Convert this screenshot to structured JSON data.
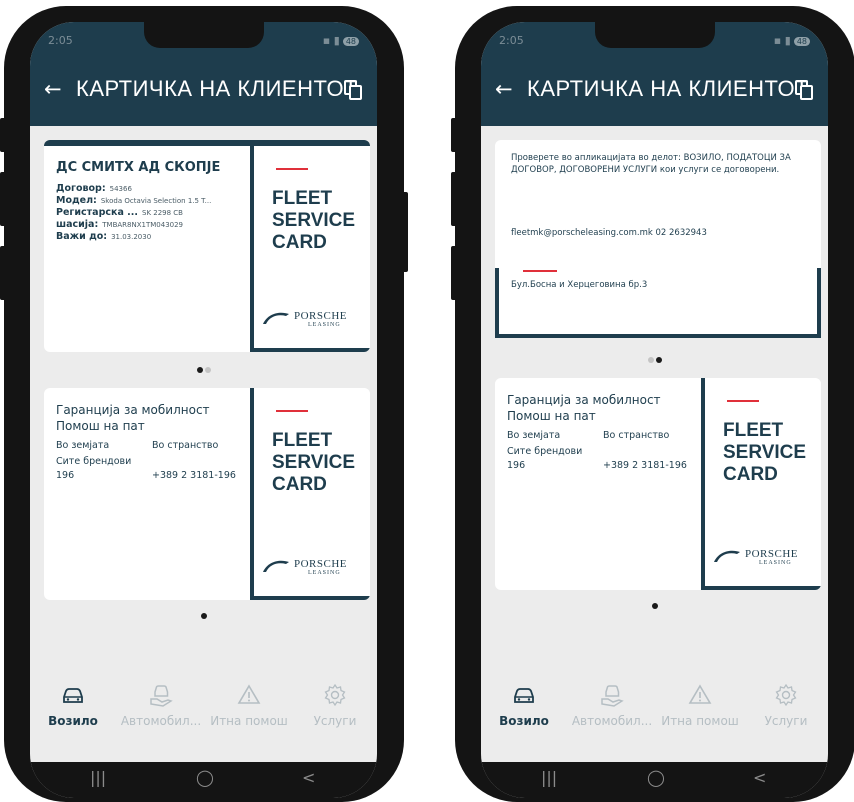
{
  "screens": [
    {
      "status": {
        "time": "2:05",
        "battery": "48"
      },
      "title": "КАРТИЧКА НА КЛИЕНТОТ",
      "vehicle_card": {
        "company": "ДС СМИТХ АД СКОПЈЕ",
        "rows": [
          {
            "label": "Договор:",
            "value": "54366"
          },
          {
            "label": "Модел:",
            "value": "Skoda Octavia Selection 1.5 T..."
          },
          {
            "label": "Регистарска ...",
            "value": "SK 2298 CB"
          },
          {
            "label": "шасија:",
            "value": "TMBAR8NX1TM043029"
          },
          {
            "label": "Важи до:",
            "value": "31.03.2030"
          }
        ]
      },
      "pager_1_active": 0,
      "guarantee_card": {
        "title_line1": "Гаранција за мобилност",
        "title_line2": "Помош на пат",
        "col_domestic": "Во земјата",
        "col_abroad": "Во странство",
        "all_brands": "Сите брендови",
        "domestic_number": "196",
        "abroad_number": "+389 2 3181-196"
      }
    },
    {
      "status": {
        "time": "2:05",
        "battery": "48"
      },
      "title": "КАРТИЧКА НА КЛИЕНТОТ",
      "info_card": {
        "instructions": "Проверете во апликацијата во делот: ВОЗИЛО, ПОДАТОЦИ ЗА ДОГОВОР, ДОГОВОРЕНИ УСЛУГИ кои услуги се договорени.",
        "contact": "fleetmk@porscheleasing.com.mk 02 2632943",
        "address": "Бул.Босна и Херцеговина бр.3"
      },
      "pager_1_active": 1,
      "guarantee_card": {
        "title_line1": "Гаранција за мобилност",
        "title_line2": "Помош на пат",
        "col_domestic": "Во земјата",
        "col_abroad": "Во странство",
        "all_brands": "Сите брендови",
        "domestic_number": "196",
        "abroad_number": "+389 2 3181-196"
      }
    }
  ],
  "brand_card": {
    "line1": "FLEET",
    "line2": "SERVICE",
    "line3": "CARD",
    "logo_word": "PORSCHE",
    "logo_sub": "LEASING"
  },
  "nav": [
    {
      "label": "Возило",
      "icon": "car-icon",
      "active": true
    },
    {
      "label": "Автомобил...",
      "icon": "car-service-icon",
      "active": false
    },
    {
      "label": "Итна помош",
      "icon": "warning-icon",
      "active": false
    },
    {
      "label": "Услуги",
      "icon": "gear-icon",
      "active": false
    }
  ],
  "system_nav": {
    "recents": "|||",
    "home": "◯",
    "back": "<"
  },
  "colors": {
    "primary": "#1e3d4d",
    "accent_red": "#e0303a",
    "background": "#ececec"
  }
}
